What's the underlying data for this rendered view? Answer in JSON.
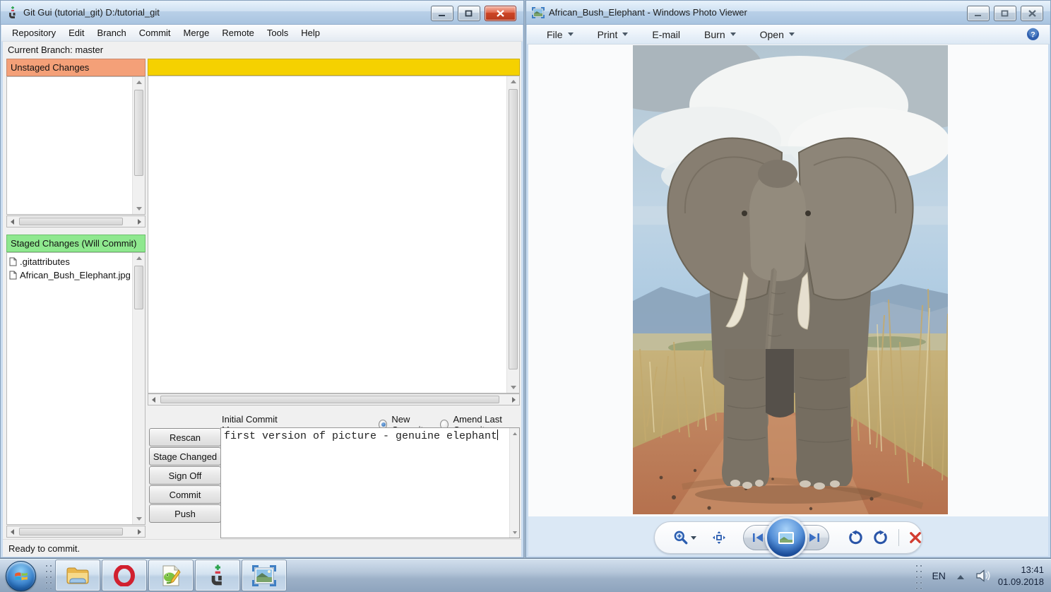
{
  "git": {
    "title": "Git Gui (tutorial_git) D:/tutorial_git",
    "menu": [
      "Repository",
      "Edit",
      "Branch",
      "Commit",
      "Merge",
      "Remote",
      "Tools",
      "Help"
    ],
    "branch_line": "Current Branch: master",
    "unstaged_header": "Unstaged Changes",
    "staged_header": "Staged Changes (Will Commit)",
    "staged_files": [
      ".gitattributes",
      "African_Bush_Elephant.jpg"
    ],
    "commit_label": "Initial Commit Message:",
    "radio_new_commit": "New Commit",
    "radio_amend": "Amend Last Commit",
    "btn_rescan": "Rescan",
    "btn_stage_changed": "Stage Changed",
    "btn_sign_off": "Sign Off",
    "btn_commit": "Commit",
    "btn_push": "Push",
    "commit_message": "first version of picture - genuine elephant",
    "status": "Ready to commit."
  },
  "viewer": {
    "title": "African_Bush_Elephant - Windows Photo Viewer",
    "menu_file": "File",
    "menu_print": "Print",
    "menu_email": "E-mail",
    "menu_burn": "Burn",
    "menu_open": "Open"
  },
  "tray": {
    "lang": "EN",
    "time": "13:41",
    "date": "01.09.2018"
  },
  "icons": {
    "git-logo-icon": "green plus / red minus / dark G hook",
    "photo-viewer-icon": "framed landscape",
    "help-icon": "blue circle question mark",
    "zoom-icon": "magnifier with plus",
    "fit-to-window-icon": "square with arrows",
    "previous-icon": "bar + left triangle",
    "slideshow-icon": "blue orb with picture",
    "next-icon": "right triangle + bar",
    "rotate-ccw-icon": "counterclockwise arrow",
    "rotate-cw-icon": "clockwise arrow",
    "delete-icon": "red x",
    "start-orb-icon": "windows flag",
    "explorer-icon": "yellow folder",
    "opera-icon": "red O ring",
    "notepadpp-icon": "page with chameleon and pencil",
    "volume-icon": "speaker",
    "show-hidden-icon": "up chevron"
  },
  "colors": {
    "unstaged_header_bg": "#f4a078",
    "staged_header_bg": "#8fe88f",
    "diff_topbar_bg": "#f5d100",
    "active_close_red": "#cc4526",
    "titlebar_blue": "#b9d0e8",
    "toolbar_area_blue": "#dbe8f5",
    "accent_blue": "#2a5db0"
  }
}
